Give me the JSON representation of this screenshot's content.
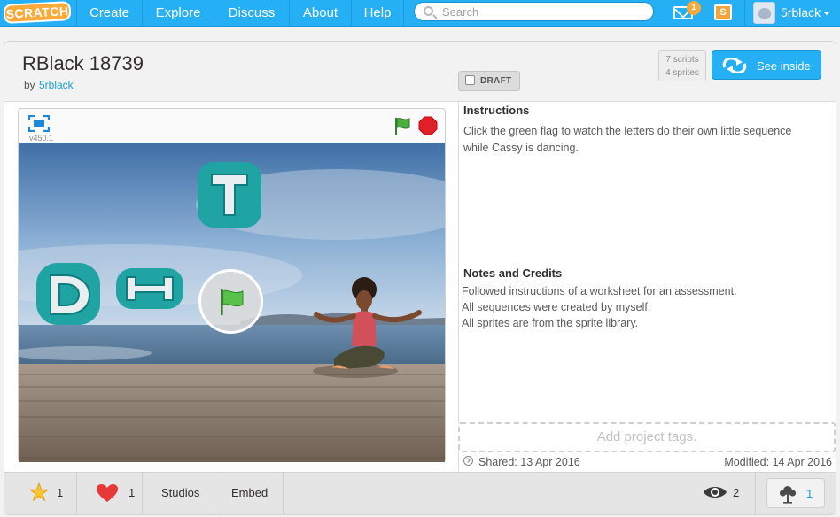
{
  "nav": {
    "logo": "SCRATCH",
    "items": [
      "Create",
      "Explore",
      "Discuss",
      "About",
      "Help"
    ],
    "search_placeholder": "Search",
    "message_count": "1",
    "mystuff_glyph": "S",
    "username": "5rblack"
  },
  "project": {
    "title": "RBlack 18739",
    "by_label": "by",
    "author": "5rblack",
    "draft_label": "DRAFT",
    "scripts": "7 scripts",
    "sprites": "4 sprites",
    "see_inside": "See inside"
  },
  "player": {
    "version": "v450.1"
  },
  "info": {
    "instructions_heading": "Instructions",
    "instructions_text": "Click the green flag to watch the letters do their own little sequence while Cassy is dancing.",
    "notes_heading": "Notes and Credits",
    "notes_lines": [
      "Followed instructions of a worksheet for an assessment.",
      "All sequences were created by myself.",
      "All sprites are from the sprite library."
    ],
    "tags_placeholder": "Add project tags.",
    "shared": "Shared: 13 Apr 2016",
    "modified": "Modified: 14 Apr 2016"
  },
  "actions": {
    "favorites": "1",
    "loves": "1",
    "studios": "Studios",
    "embed": "Embed",
    "views": "2",
    "remixes": "1"
  },
  "colors": {
    "nav_blue": "#25aff4",
    "link_blue": "#1aa0d8",
    "sprite_teal": "#1fa3a3",
    "flag_green": "#4caf3f",
    "stop_red": "#e01f26",
    "heart_red": "#e63a3a",
    "star_yellow": "#f7c52f"
  },
  "icons": {
    "search": "search-icon",
    "messages": "mail-icon",
    "mystuff": "folder-icon",
    "fullscreen": "fullscreen-icon",
    "start": "green-flag-icon",
    "stop": "stop-icon",
    "remix": "remix-icon",
    "favorite": "star-icon",
    "love": "heart-icon",
    "views": "eye-icon",
    "remix_tree": "tree-icon"
  }
}
